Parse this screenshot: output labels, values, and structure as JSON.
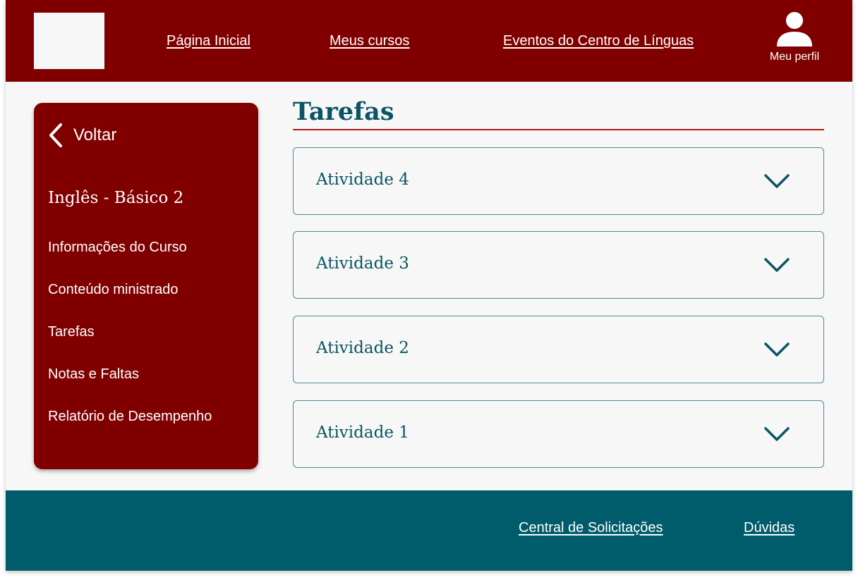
{
  "colors": {
    "header_bg": "#800000",
    "sidebar_bg": "#800000",
    "footer_bg": "#005b6b",
    "accent_text": "#0a5564",
    "title_rule": "#b01a1a",
    "card_border": "#4a8d9a",
    "page_bg": "#f7f7f7"
  },
  "header": {
    "nav": [
      {
        "label": "Página Inicial"
      },
      {
        "label": "Meus cursos"
      },
      {
        "label": "Eventos do Centro de Línguas"
      }
    ],
    "profile": {
      "label": "Meu perfil",
      "icon": "user-icon"
    }
  },
  "sidebar": {
    "back": {
      "label": "Voltar",
      "icon": "chevron-left-icon"
    },
    "course_title": "Inglês - Básico 2",
    "items": [
      {
        "label": "Informações do Curso"
      },
      {
        "label": "Conteúdo ministrado"
      },
      {
        "label": "Tarefas"
      },
      {
        "label": "Notas e Faltas"
      },
      {
        "label": "Relatório de Desempenho"
      }
    ]
  },
  "main": {
    "title": "Tarefas",
    "activities": [
      {
        "label": "Atividade 4",
        "icon": "chevron-down-icon"
      },
      {
        "label": "Atividade 3",
        "icon": "chevron-down-icon"
      },
      {
        "label": "Atividade 2",
        "icon": "chevron-down-icon"
      },
      {
        "label": "Atividade 1",
        "icon": "chevron-down-icon"
      }
    ]
  },
  "footer": {
    "links": [
      {
        "label": "Central de Solicitações"
      },
      {
        "label": "Dúvidas"
      }
    ]
  }
}
